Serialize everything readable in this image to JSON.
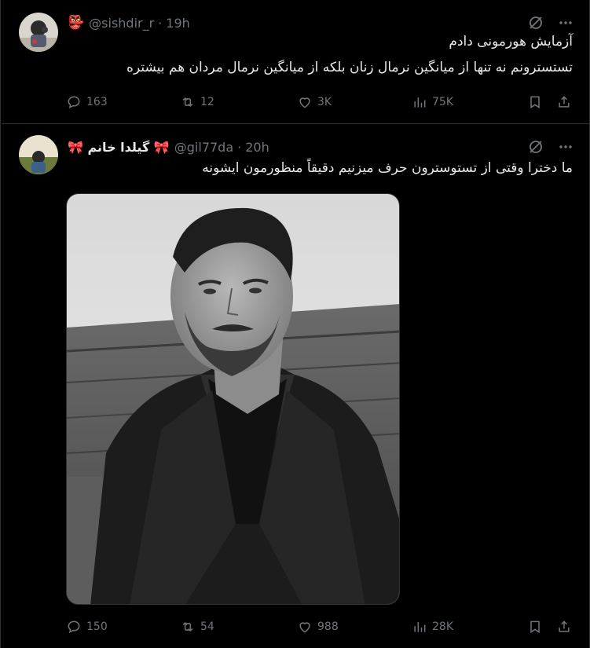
{
  "colors": {
    "background": "#000000",
    "text": "#e7e9ea",
    "muted": "#71767b",
    "divider": "#2f3336"
  },
  "tweets": [
    {
      "emoji": "👺",
      "display_name": "",
      "handle": "@sishdir_r",
      "separator": "·",
      "time": "19h",
      "text_lines": [
        "آزمایش هورمونی دادم",
        "تستسترونم نه تنها از میانگین نرمال زنان بلکه از میانگین نرمال مردان هم بیشتره"
      ],
      "stats": {
        "replies": "163",
        "reposts": "12",
        "likes": "3K",
        "views": "75K"
      }
    },
    {
      "display_name": "🎀 گیلدا خانم 🎀",
      "handle": "@gil77da",
      "separator": "·",
      "time": "20h",
      "text_lines": [
        "ما دخترا وقتی از تستوسترون حرف میزنیم دقیقاً منظورمون ایشونه"
      ],
      "has_media": true,
      "stats": {
        "replies": "150",
        "reposts": "54",
        "likes": "988",
        "views": "28K"
      }
    }
  ],
  "icons": {
    "grok": "grok-icon",
    "more": "more-icon",
    "reply": "reply-icon",
    "repost": "repost-icon",
    "like": "heart-icon",
    "views": "views-icon",
    "bookmark": "bookmark-icon",
    "share": "share-icon"
  }
}
